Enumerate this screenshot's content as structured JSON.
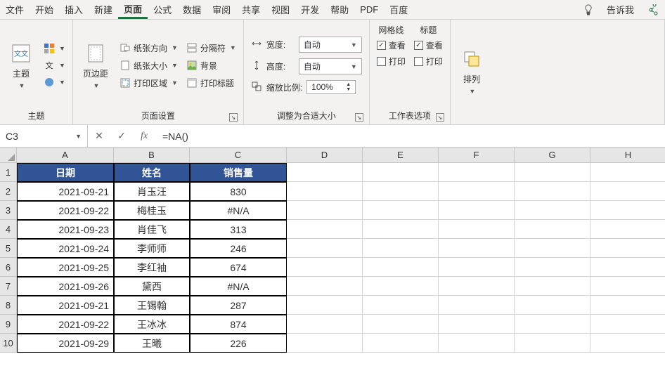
{
  "menu": {
    "items": [
      "文件",
      "开始",
      "插入",
      "新建",
      "页面",
      "公式",
      "数据",
      "审阅",
      "共享",
      "视图",
      "开发",
      "帮助",
      "PDF",
      "百度"
    ],
    "active_index": 4,
    "tell_me": "告诉我",
    "share_icon": "share-icon"
  },
  "ribbon": {
    "groups": {
      "theme": {
        "label": "主题",
        "theme_btn": "主题",
        "sub_btns": [
          "文",
          "文",
          ""
        ]
      },
      "page_setup": {
        "label": "页面设置",
        "margins": "页边距",
        "orientation": "纸张方向",
        "size": "纸张大小",
        "print_area": "打印区域",
        "breaks": "分隔符",
        "background": "背景",
        "print_titles": "打印标题"
      },
      "scale": {
        "label": "调整为合适大小",
        "width_label": "宽度:",
        "width_value": "自动",
        "height_label": "高度:",
        "height_value": "自动",
        "scale_label": "缩放比例:",
        "scale_value": "100%"
      },
      "sheet_options": {
        "label": "工作表选项",
        "gridlines": "网格线",
        "headings": "标题",
        "view": "查看",
        "print": "打印",
        "gridlines_view": true,
        "gridlines_print": false,
        "headings_view": true,
        "headings_print": false
      },
      "arrange": {
        "label": "排列"
      }
    }
  },
  "formula_bar": {
    "name_box": "C3",
    "formula": "=NA()"
  },
  "sheet": {
    "columns": [
      "A",
      "B",
      "C",
      "D",
      "E",
      "F",
      "G",
      "H"
    ],
    "row_numbers": [
      "1",
      "2",
      "3",
      "4",
      "5",
      "6",
      "7",
      "8",
      "9",
      "10"
    ],
    "headers": [
      "日期",
      "姓名",
      "销售量"
    ],
    "rows": [
      {
        "date": "2021-09-21",
        "name": "肖玉汪",
        "sales": "830"
      },
      {
        "date": "2021-09-22",
        "name": "梅桂玉",
        "sales": "#N/A"
      },
      {
        "date": "2021-09-23",
        "name": "肖佳飞",
        "sales": "313"
      },
      {
        "date": "2021-09-24",
        "name": "李师师",
        "sales": "246"
      },
      {
        "date": "2021-09-25",
        "name": "李红袖",
        "sales": "674"
      },
      {
        "date": "2021-09-26",
        "name": "黛西",
        "sales": "#N/A"
      },
      {
        "date": "2021-09-21",
        "name": "王锡翰",
        "sales": "287"
      },
      {
        "date": "2021-09-22",
        "name": "王冰冰",
        "sales": "874"
      },
      {
        "date": "2021-09-29",
        "name": "王曦",
        "sales": "226"
      }
    ]
  }
}
